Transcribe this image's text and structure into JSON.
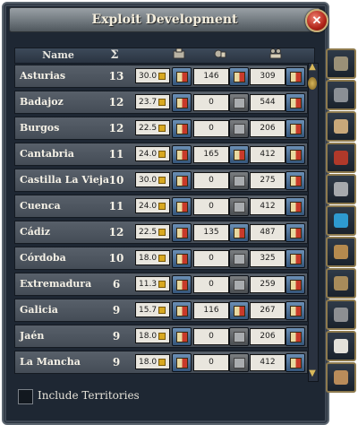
{
  "window": {
    "title": "Exploit Development",
    "close_glyph": "✕"
  },
  "table": {
    "headers": {
      "name": "Name",
      "dev": "Σ"
    },
    "rows": [
      {
        "name": "Asturias",
        "dev": "13",
        "cost": "30.0",
        "v2": "146",
        "v3": "309",
        "b1": "active",
        "b2": "active",
        "b3": "active"
      },
      {
        "name": "Badajoz",
        "dev": "12",
        "cost": "23.7",
        "v2": "0",
        "v3": "544",
        "b1": "active",
        "b2": "disabled",
        "b3": "active"
      },
      {
        "name": "Burgos",
        "dev": "12",
        "cost": "22.5",
        "v2": "0",
        "v3": "206",
        "b1": "active",
        "b2": "disabled",
        "b3": "active"
      },
      {
        "name": "Cantabria",
        "dev": "11",
        "cost": "24.0",
        "v2": "165",
        "v3": "412",
        "b1": "active",
        "b2": "active",
        "b3": "active"
      },
      {
        "name": "Castilla La Vieja",
        "dev": "10",
        "cost": "30.0",
        "v2": "0",
        "v3": "275",
        "b1": "active",
        "b2": "disabled",
        "b3": "active"
      },
      {
        "name": "Cuenca",
        "dev": "11",
        "cost": "24.0",
        "v2": "0",
        "v3": "412",
        "b1": "active",
        "b2": "disabled",
        "b3": "active"
      },
      {
        "name": "Cádiz",
        "dev": "12",
        "cost": "22.5",
        "v2": "135",
        "v3": "487",
        "b1": "active",
        "b2": "active",
        "b3": "active"
      },
      {
        "name": "Córdoba",
        "dev": "10",
        "cost": "18.0",
        "v2": "0",
        "v3": "325",
        "b1": "active",
        "b2": "disabled",
        "b3": "active"
      },
      {
        "name": "Extremadura",
        "dev": "6",
        "cost": "11.3",
        "v2": "0",
        "v3": "259",
        "b1": "active",
        "b2": "disabled",
        "b3": "active"
      },
      {
        "name": "Galicia",
        "dev": "9",
        "cost": "15.7",
        "v2": "116",
        "v3": "267",
        "b1": "active",
        "b2": "active",
        "b3": "active"
      },
      {
        "name": "Jaén",
        "dev": "9",
        "cost": "18.0",
        "v2": "0",
        "v3": "206",
        "b1": "active",
        "b2": "disabled",
        "b3": "active"
      },
      {
        "name": "La Mancha",
        "dev": "9",
        "cost": "18.0",
        "v2": "0",
        "v3": "412",
        "b1": "active",
        "b2": "disabled",
        "b3": "active"
      }
    ]
  },
  "footer": {
    "checkbox_label": "Include Territories",
    "checked": false
  },
  "sidebar": {
    "icons": [
      "province-map-icon",
      "ships-icon",
      "add-building-icon",
      "religion-icon",
      "chain-icon",
      "trade-arrows-icon",
      "military-icon",
      "map-scroll-icon",
      "army-units-icon",
      "dove-icon",
      "deed-icon"
    ]
  },
  "colors": {
    "accent": "#8d7a4e",
    "panel": "#1e2733",
    "row": "#4c545e"
  }
}
